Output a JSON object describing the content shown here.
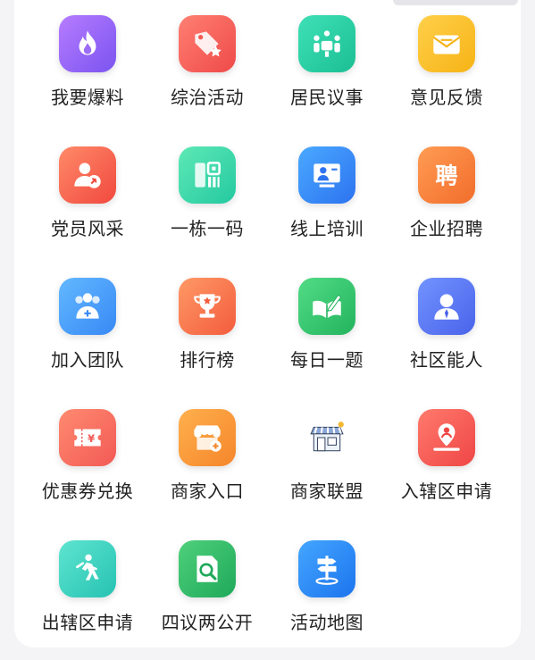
{
  "items": [
    {
      "label": "我要爆料",
      "icon": "flame-icon",
      "colors": [
        "#b67cff",
        "#7b54f0"
      ]
    },
    {
      "label": "综治活动",
      "icon": "tag-star-icon",
      "colors": [
        "#ff7f73",
        "#ef4a49"
      ]
    },
    {
      "label": "居民议事",
      "icon": "meeting-icon",
      "colors": [
        "#3fe0b7",
        "#1bbf93"
      ]
    },
    {
      "label": "意见反馈",
      "icon": "envelope-icon",
      "colors": [
        "#ffd04a",
        "#f6b316"
      ]
    },
    {
      "label": "党员风采",
      "icon": "party-member-icon",
      "colors": [
        "#ff8a69",
        "#f1493e"
      ]
    },
    {
      "label": "一栋一码",
      "icon": "qr-code-icon",
      "colors": [
        "#5ee9b6",
        "#24c9a0"
      ]
    },
    {
      "label": "线上培训",
      "icon": "online-training-icon",
      "colors": [
        "#4aa9ff",
        "#2d73f0"
      ]
    },
    {
      "label": "企业招聘",
      "icon": "recruit-icon",
      "colors": [
        "#ff9c54",
        "#f26d2b"
      ]
    },
    {
      "label": "加入团队",
      "icon": "team-icon",
      "colors": [
        "#63b8ff",
        "#3889f5"
      ]
    },
    {
      "label": "排行榜",
      "icon": "trophy-icon",
      "colors": [
        "#ff9966",
        "#f35c3d"
      ]
    },
    {
      "label": "每日一题",
      "icon": "book-pen-icon",
      "colors": [
        "#52db86",
        "#23b45d"
      ]
    },
    {
      "label": "社区能人",
      "icon": "person-icon",
      "colors": [
        "#7293ff",
        "#4a63ea"
      ]
    },
    {
      "label": "优惠券兑换",
      "icon": "coupon-icon",
      "colors": [
        "#ff8a70",
        "#f25a55"
      ]
    },
    {
      "label": "商家入口",
      "icon": "shop-entry-icon",
      "colors": [
        "#ffb04d",
        "#f5862b"
      ]
    },
    {
      "label": "商家联盟",
      "icon": "storefront-icon",
      "colors": [
        "#ffffff",
        "#ffffff"
      ]
    },
    {
      "label": "入辖区申请",
      "icon": "location-person-icon",
      "colors": [
        "#ff7a6c",
        "#ef4646"
      ]
    },
    {
      "label": "出辖区申请",
      "icon": "walking-exit-icon",
      "colors": [
        "#5ee5d0",
        "#26c2b2"
      ]
    },
    {
      "label": "四议两公开",
      "icon": "document-search-icon",
      "colors": [
        "#4fd07b",
        "#1ea95a"
      ]
    },
    {
      "label": "活动地图",
      "icon": "signpost-icon",
      "colors": [
        "#44a6ff",
        "#1c74ee"
      ]
    }
  ]
}
